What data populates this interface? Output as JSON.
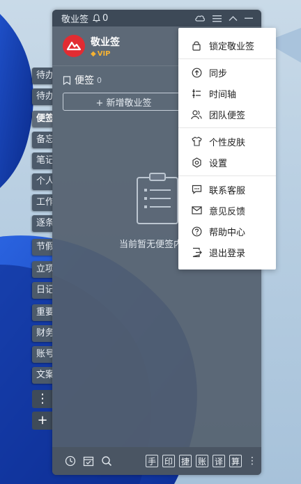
{
  "app": {
    "title": "敬业签",
    "notify_count": "0",
    "user_name": "敬业签",
    "vip_label": "VIP"
  },
  "sidebar": {
    "tabs": [
      {
        "label": "待办"
      },
      {
        "label": "待办"
      },
      {
        "label": "便签"
      },
      {
        "label": "备忘"
      },
      {
        "label": "笔记"
      },
      {
        "label": "个人"
      },
      {
        "label": "工作"
      },
      {
        "label": "逐条"
      },
      {
        "label": "节假"
      },
      {
        "label": "立项"
      },
      {
        "label": "日记"
      },
      {
        "label": "重要"
      },
      {
        "label": "财务"
      },
      {
        "label": "账号"
      },
      {
        "label": "文案"
      }
    ],
    "more_label": "⋮",
    "add_label": "+"
  },
  "main": {
    "section_title": "便签",
    "section_count": "0",
    "add_button": "+ 新增敬业签",
    "empty_text": "当前暂无便签内容"
  },
  "bottom": {
    "chips": [
      "手",
      "印",
      "捷",
      "账",
      "译",
      "算"
    ]
  },
  "menu": {
    "items": [
      {
        "label": "锁定敬业签",
        "icon": "lock-icon"
      },
      {
        "label": "同步",
        "icon": "sync-icon"
      },
      {
        "label": "时间轴",
        "icon": "timeline-icon"
      },
      {
        "label": "团队便签",
        "icon": "team-icon"
      },
      {
        "label": "个性皮肤",
        "icon": "skin-icon"
      },
      {
        "label": "设置",
        "icon": "gear-icon"
      },
      {
        "label": "联系客服",
        "icon": "chat-icon"
      },
      {
        "label": "意见反馈",
        "icon": "mail-icon"
      },
      {
        "label": "帮助中心",
        "icon": "help-icon"
      },
      {
        "label": "退出登录",
        "icon": "logout-icon"
      }
    ]
  },
  "colors": {
    "accent_red": "#e22c32",
    "vip_gold": "#f5b233",
    "window_bg": "#54606e",
    "menu_bg": "#ffffff"
  }
}
